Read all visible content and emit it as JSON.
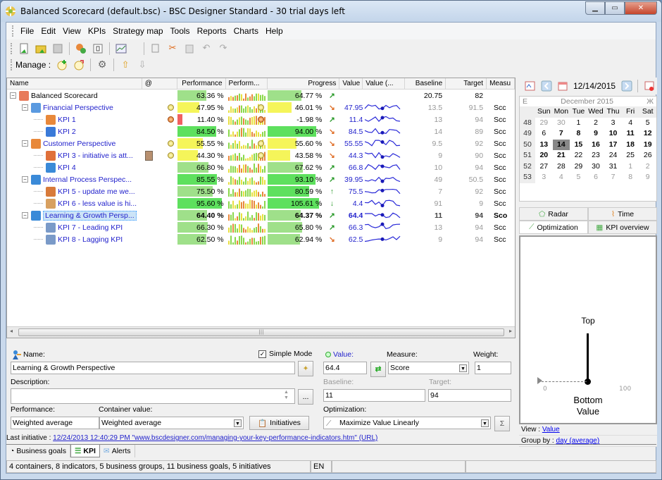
{
  "window": {
    "title": "Balanced Scorecard (default.bsc) - BSC Designer Standard - 30 trial days left"
  },
  "menu": [
    "File",
    "Edit",
    "View",
    "KPIs",
    "Strategy map",
    "Tools",
    "Reports",
    "Charts",
    "Help"
  ],
  "toolbar": {
    "manage_label": "Manage :"
  },
  "columns": [
    "Name",
    "@",
    "Performance",
    "Perform...",
    "Progress",
    "Value",
    "Value (...",
    "Baseline",
    "Target",
    "Measu"
  ],
  "rows": [
    {
      "name": "Balanced Scorecard",
      "level": 0,
      "icon": "scorecard",
      "perf": "63.36 %",
      "perf_pct": 63.36,
      "led": "",
      "prog": "64.77 %",
      "prog_pct": 64.77,
      "prog_led": "",
      "arrow": "up-right",
      "value": "",
      "baseline": "20.75",
      "target": "82",
      "measure": "",
      "root": true
    },
    {
      "name": "Financial Perspective",
      "level": 1,
      "icon": "financial",
      "perf": "47.95 %",
      "perf_pct": 47.95,
      "led": "y",
      "prog": "46.01 %",
      "prog_pct": 46.01,
      "prog_led": "y",
      "arrow": "down-right",
      "value": "47.95",
      "baseline": "13.5",
      "target": "91.5",
      "measure": "Scc"
    },
    {
      "name": "KPI 1",
      "level": 2,
      "icon": "kpi1",
      "perf": "11.40 %",
      "perf_pct": 11.4,
      "led": "o",
      "prog": "-1.98 %",
      "prog_pct": 0,
      "prog_led": "o",
      "arrow": "up-right",
      "value": "11.4",
      "baseline": "13",
      "target": "94",
      "measure": "Scc"
    },
    {
      "name": "KPI 2",
      "level": 2,
      "icon": "kpi2",
      "perf": "84.50 %",
      "perf_pct": 84.5,
      "led": "",
      "prog": "94.00 %",
      "prog_pct": 94,
      "prog_led": "",
      "arrow": "down-right",
      "value": "84.5",
      "baseline": "14",
      "target": "89",
      "measure": "Scc"
    },
    {
      "name": "Customer Perspective",
      "level": 1,
      "icon": "customer",
      "perf": "55.55 %",
      "perf_pct": 55.55,
      "led": "y",
      "prog": "55.60 %",
      "prog_pct": 55.6,
      "prog_led": "y",
      "arrow": "down-right",
      "value": "55.55",
      "baseline": "9.5",
      "target": "92",
      "measure": "Scc"
    },
    {
      "name": "KPI 3 - initiative is att...",
      "level": 2,
      "icon": "kpi3",
      "perf": "44.30 %",
      "perf_pct": 44.3,
      "led": "y",
      "prog": "43.58 %",
      "prog_pct": 43.58,
      "prog_led": "y",
      "arrow": "down-right",
      "value": "44.3",
      "baseline": "9",
      "target": "90",
      "measure": "Scc",
      "initiative": true
    },
    {
      "name": "KPI 4",
      "level": 2,
      "icon": "kpi4",
      "perf": "66.80 %",
      "perf_pct": 66.8,
      "led": "",
      "prog": "67.62 %",
      "prog_pct": 67.62,
      "prog_led": "",
      "arrow": "up-right",
      "value": "66.8",
      "baseline": "10",
      "target": "94",
      "measure": "Scc"
    },
    {
      "name": "Internal Process Perspec...",
      "level": 1,
      "icon": "internal",
      "perf": "85.55 %",
      "perf_pct": 85.55,
      "led": "",
      "prog": "93.10 %",
      "prog_pct": 93.1,
      "prog_led": "",
      "arrow": "up-right",
      "value": "39.95",
      "baseline": "49",
      "target": "50.5",
      "measure": "Scc"
    },
    {
      "name": "KPI 5 - update me we...",
      "level": 2,
      "icon": "kpi5",
      "perf": "75.50 %",
      "perf_pct": 75.5,
      "led": "",
      "prog": "80.59 %",
      "prog_pct": 80.59,
      "prog_led": "",
      "arrow": "up",
      "value": "75.5",
      "baseline": "7",
      "target": "92",
      "measure": "Scc"
    },
    {
      "name": "KPI 6 - less value is hi...",
      "level": 2,
      "icon": "kpi6",
      "perf": "95.60 %",
      "perf_pct": 95.6,
      "led": "",
      "prog": "105.61 %",
      "prog_pct": 100,
      "prog_led": "",
      "arrow": "down",
      "value": "4.4",
      "baseline": "91",
      "target": "9",
      "measure": "Scc"
    },
    {
      "name": "Learning & Growth Persp...",
      "level": 1,
      "icon": "learning",
      "perf": "64.40 %",
      "perf_pct": 64.4,
      "led": "",
      "prog": "64.37 %",
      "prog_pct": 64.37,
      "prog_led": "",
      "arrow": "up-right",
      "value": "64.4",
      "baseline": "11",
      "target": "94",
      "measure": "Sco",
      "selected": true
    },
    {
      "name": "KPI 7 - Leading KPI",
      "level": 2,
      "icon": "kpi7",
      "perf": "66.30 %",
      "perf_pct": 66.3,
      "led": "",
      "prog": "65.80 %",
      "prog_pct": 65.8,
      "prog_led": "",
      "arrow": "up-right",
      "value": "66.3",
      "baseline": "13",
      "target": "94",
      "measure": "Scc"
    },
    {
      "name": "KPI 8 - Lagging KPI",
      "level": 2,
      "icon": "kpi8",
      "perf": "62.50 %",
      "perf_pct": 62.5,
      "led": "",
      "prog": "62.94 %",
      "prog_pct": 62.94,
      "prog_led": "",
      "arrow": "down-right",
      "value": "62.5",
      "baseline": "9",
      "target": "94",
      "measure": "Scc"
    }
  ],
  "calendar": {
    "date": "12/14/2015",
    "month": "December 2015",
    "prev": "E",
    "next": "Ж",
    "days": [
      "Sun",
      "Mon",
      "Tue",
      "Wed",
      "Thu",
      "Fri",
      "Sat"
    ],
    "weeks": [
      {
        "wk": "48",
        "d": [
          "29",
          "30",
          "1",
          "2",
          "3",
          "4",
          "5"
        ],
        "cls": [
          "dim",
          "dim",
          "",
          "",
          "",
          "",
          ""
        ]
      },
      {
        "wk": "49",
        "d": [
          "6",
          "7",
          "8",
          "9",
          "10",
          "11",
          "12"
        ],
        "cls": [
          "",
          "b",
          "b",
          "b",
          "b",
          "b",
          "b"
        ]
      },
      {
        "wk": "50",
        "d": [
          "13",
          "14",
          "15",
          "16",
          "17",
          "18",
          "19"
        ],
        "cls": [
          "b",
          "today",
          "b",
          "b",
          "b",
          "b",
          "b"
        ]
      },
      {
        "wk": "51",
        "d": [
          "20",
          "21",
          "22",
          "23",
          "24",
          "25",
          "26"
        ],
        "cls": [
          "b",
          "b",
          "",
          "",
          "",
          "",
          ""
        ]
      },
      {
        "wk": "52",
        "d": [
          "27",
          "28",
          "29",
          "30",
          "31",
          "1",
          "2"
        ],
        "cls": [
          "",
          "",
          "",
          "",
          "",
          "dim",
          "dim"
        ]
      },
      {
        "wk": "53",
        "d": [
          "3",
          "4",
          "5",
          "6",
          "7",
          "8",
          "9"
        ],
        "cls": [
          "dim",
          "dim",
          "dim",
          "dim",
          "dim",
          "dim",
          "dim"
        ]
      }
    ]
  },
  "chart_tabs": {
    "radar": "Radar",
    "time": "Time",
    "optimization": "Optimization",
    "kpi_overview": "KPI overview"
  },
  "gauge": {
    "top": "Top",
    "bottom": "Bottom",
    "value_label": "Value",
    "min": "0",
    "max": "100"
  },
  "panel_links": {
    "view_label": "View :",
    "view_value": "Value",
    "group_label": "Group by :",
    "group_value": "day (average)"
  },
  "editor": {
    "name_label": "Name:",
    "name_value": "Learning & Growth Perspective",
    "simple_mode": "Simple Mode",
    "description_label": "Description:",
    "description_value": "",
    "more_btn": "...",
    "performance_label": "Performance:",
    "performance_value": "Weighted average",
    "container_label": "Container value:",
    "container_value": "Weighted average",
    "initiatives_btn": "Initiatives",
    "value_label": "Value:",
    "value_value": "64.4",
    "measure_label": "Measure:",
    "measure_value": "Score",
    "weight_label": "Weight:",
    "weight_value": "1",
    "baseline_label": "Baseline:",
    "baseline_value": "11",
    "target_label": "Target:",
    "target_value": "94",
    "optimization_label": "Optimization:",
    "optimization_value": "Maximize Value Linearly"
  },
  "last_initiative": {
    "label": "Last initiative :",
    "link": "12/24/2013 12:40:29 PM  \"www.bscdesigner.com/managing-your-key-performance-indicators.htm\" (URL)"
  },
  "bottom_tabs": [
    "Business goals",
    "KPI",
    "Alerts"
  ],
  "status": {
    "summary": "4 containers, 8 indicators, 5 business groups, 11 business goals, 5 initiatives",
    "lang": "EN"
  },
  "colors": {
    "green": "#5ee05e",
    "light_green": "#9fe08a",
    "yellow": "#f5f55a",
    "red": "#f06060",
    "link": "#2222cc"
  }
}
